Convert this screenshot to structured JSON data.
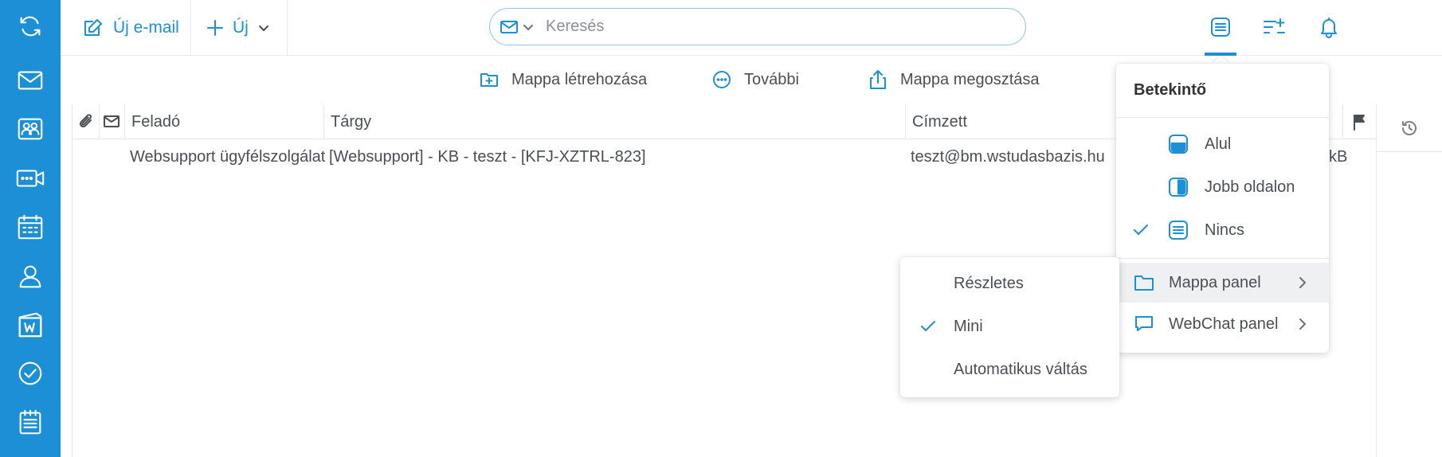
{
  "toolbar": {
    "new_email_label": "Új e-mail",
    "new_label": "Új"
  },
  "search": {
    "placeholder": "Keresés"
  },
  "secondary_toolbar": {
    "create_folder_label": "Mappa létrehozása",
    "more_label": "További",
    "share_folder_label": "Mappa megosztása"
  },
  "mail_list": {
    "columns": {
      "sender": "Feladó",
      "subject": "Tárgy",
      "recipient": "Címzett"
    },
    "rows": [
      {
        "sender": "Websupport ügyfélszolgálat",
        "subject": "[Websupport] - KB - teszt - [KFJ-XZTRL-823]",
        "recipient": "teszt@bm.wstudasbazis.hu",
        "size": "kB"
      }
    ]
  },
  "preview_menu": {
    "title": "Betekintő",
    "items": [
      {
        "label": "Alul",
        "icon": "preview-bottom-icon",
        "checked": false
      },
      {
        "label": "Jobb oldalon",
        "icon": "preview-right-icon",
        "checked": false
      },
      {
        "label": "Nincs",
        "icon": "preview-none-icon",
        "checked": true
      }
    ],
    "submenus": [
      {
        "label": "Mappa panel",
        "icon": "folder-icon"
      },
      {
        "label": "WebChat panel",
        "icon": "chat-bubble-icon"
      }
    ]
  },
  "folder_panel_menu": {
    "items": [
      {
        "label": "Részletes",
        "checked": false
      },
      {
        "label": "Mini",
        "checked": true
      },
      {
        "label": "Automatikus váltás",
        "checked": false
      }
    ]
  },
  "colors": {
    "accent": "#1c8fd6",
    "status_online": "#22b14c"
  }
}
